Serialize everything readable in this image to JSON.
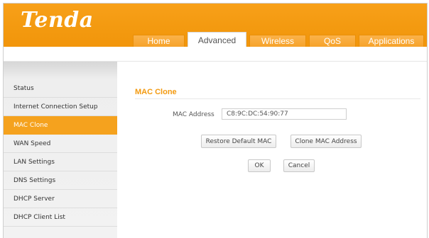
{
  "brand": {
    "logo_text": "Tenda",
    "accent": "#f39a10",
    "header_color": "#f5a21e"
  },
  "nav": {
    "tabs": [
      {
        "label": "Home",
        "active": false
      },
      {
        "label": "Advanced",
        "active": true
      },
      {
        "label": "Wireless",
        "active": false
      },
      {
        "label": "QoS",
        "active": false
      },
      {
        "label": "Applications",
        "active": false
      }
    ]
  },
  "sidebar": {
    "items": [
      {
        "label": "Status",
        "active": false
      },
      {
        "label": "Internet Connection Setup",
        "active": false
      },
      {
        "label": "MAC Clone",
        "active": true
      },
      {
        "label": "WAN Speed",
        "active": false
      },
      {
        "label": "LAN Settings",
        "active": false
      },
      {
        "label": "DNS Settings",
        "active": false
      },
      {
        "label": "DHCP Server",
        "active": false
      },
      {
        "label": "DHCP Client List",
        "active": false
      }
    ]
  },
  "main": {
    "section_title": "MAC Clone",
    "mac_label": "MAC Address",
    "mac_value": "C8:9C:DC:54:90:77",
    "restore_label": "Restore Default MAC",
    "clone_label": "Clone MAC Address",
    "ok_label": "OK",
    "cancel_label": "Cancel"
  }
}
